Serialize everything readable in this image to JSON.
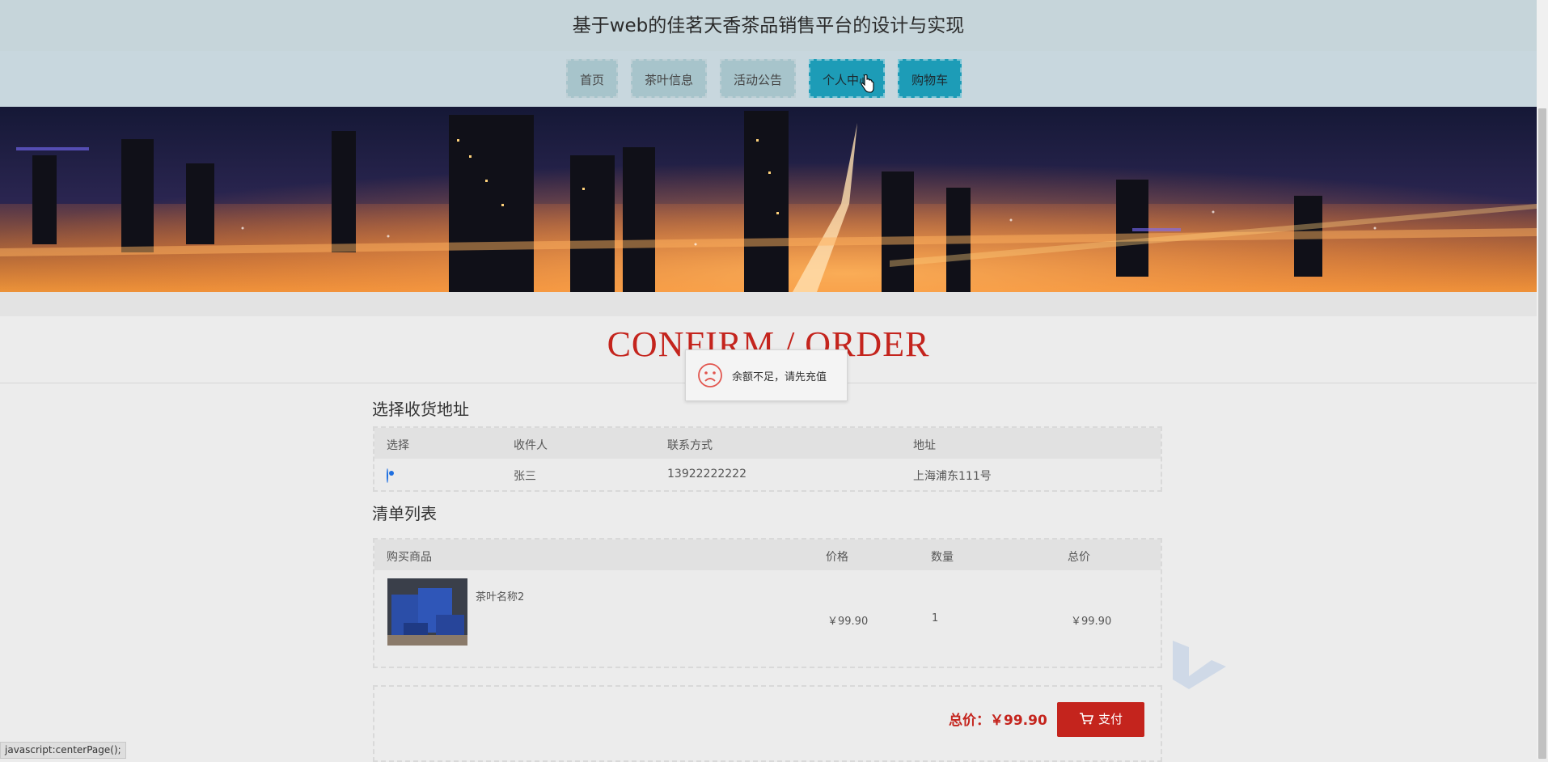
{
  "header": {
    "title": "基于web的佳茗天香茶品销售平台的设计与实现"
  },
  "nav": {
    "items": [
      "首页",
      "茶叶信息",
      "活动公告",
      "个人中心",
      "购物车"
    ]
  },
  "confirm": {
    "heading": "CONFIRM / ORDER"
  },
  "toast": {
    "message": "余额不足，请先充值",
    "icon": "sad-face-icon"
  },
  "address": {
    "title": "选择收货地址",
    "columns": [
      "选择",
      "收件人",
      "联系方式",
      "地址"
    ],
    "rows": [
      {
        "recipient": "张三",
        "phone": "13922222222",
        "address": "上海浦东111号",
        "selected": true
      }
    ]
  },
  "order": {
    "title": "清单列表",
    "columns": [
      "购买商品",
      "价格",
      "数量",
      "总价"
    ],
    "rows": [
      {
        "name": "茶叶名称2",
        "price": "￥99.90",
        "qty": "1",
        "total": "￥99.90"
      }
    ]
  },
  "summary": {
    "total_label": "总价：￥99.90",
    "pay_label": "支付"
  },
  "status_bar": {
    "text": "javascript:centerPage();"
  },
  "colors": {
    "accent": "#c4241d",
    "nav_active": "#1d9cb7",
    "header_bg": "#c6d5da"
  }
}
